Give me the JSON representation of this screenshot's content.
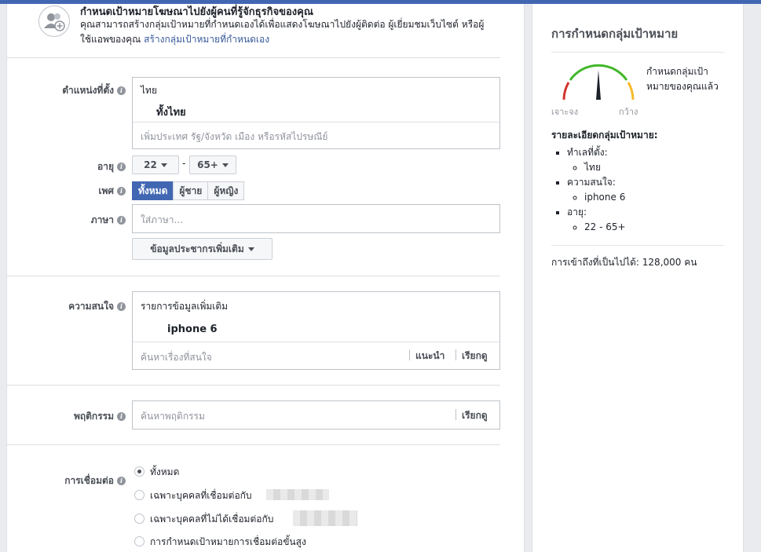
{
  "header": {
    "title": "กำหนดเป้าหมายโฆษณาไปยังผู้คนที่รู้จักธุรกิจของคุณ",
    "description": "คุณสามารถสร้างกลุ่มเป้าหมายที่กำหนดเองได้เพื่อแสดงโฆษณาไปยังผู้ติดต่อ ผู้เยี่ยมชมเว็บไซต์ หรือผู้ใช้แอพของคุณ",
    "create_link": "สร้างกลุ่มเป้าหมายที่กำหนดเอง"
  },
  "location": {
    "label": "ตำแหน่งที่ตั้ง",
    "country": "ไทย",
    "selected": "ทั้งไทย",
    "placeholder": "เพิ่มประเทศ รัฐ/จังหวัด เมือง หรือรหัสไปรษณีย์"
  },
  "age": {
    "label": "อายุ",
    "min": "22",
    "separator": "-",
    "max": "65+"
  },
  "gender": {
    "label": "เพศ",
    "options": [
      "ทั้งหมด",
      "ผู้ชาย",
      "ผู้หญิง"
    ],
    "selected": "ทั้งหมด"
  },
  "language": {
    "label": "ภาษา",
    "placeholder": "ใส่ภาษา..."
  },
  "more_demographics": "ข้อมูลประชากรเพิ่มเติม",
  "interests": {
    "label": "ความสนใจ",
    "group_title": "รายการข้อมูลเพิ่มเติม",
    "item": "iphone 6",
    "placeholder": "ค้นหาเรื่องที่สนใจ",
    "suggest": "แนะนำ",
    "browse": "เรียกดู"
  },
  "behaviors": {
    "label": "พฤติกรรม",
    "placeholder": "ค้นหาพฤติกรรม",
    "browse": "เรียกดู"
  },
  "connections": {
    "label": "การเชื่อมต่อ",
    "options": [
      "ทั้งหมด",
      "เฉพาะบุคคลที่เชื่อมต่อกับ",
      "เฉพาะบุคคลที่ไม่ได้เชื่อมต่อกับ",
      "การกำหนดเป้าหมายการเชื่อมต่อขั้นสูง"
    ],
    "selected_index": 0
  },
  "sidebar": {
    "title": "การกำหนดกลุ่มเป้าหมาย",
    "meter_text": "กำหนดกลุ่มเป้าหมายของคุณแล้ว",
    "meter_left": "เจาะจง",
    "meter_right": "กว้าง",
    "details_title": "รายละเอียดกลุ่มเป้าหมาย:",
    "details": [
      {
        "name": "ทำเลที่ตั้ง:",
        "value": "ไทย"
      },
      {
        "name": "ความสนใจ:",
        "value": "iphone 6"
      },
      {
        "name": "อายุ:",
        "value": "22 - 65+"
      }
    ],
    "reach": "การเข้าถึงที่เป็นไปได้: 128,000 คน"
  },
  "colors": {
    "accent": "#4267b2",
    "link": "#365899",
    "meter_green": "#42b72a",
    "meter_red": "#d0342c",
    "meter_orange": "#f7b928"
  }
}
